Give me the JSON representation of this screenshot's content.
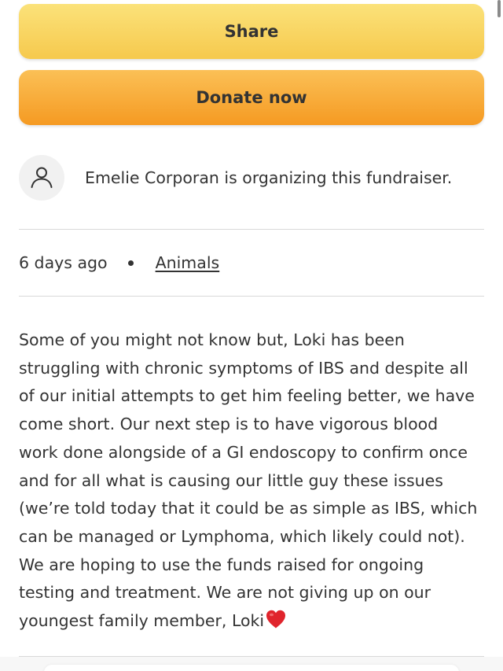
{
  "actions": {
    "share_label": "Share",
    "donate_label": "Donate now"
  },
  "organizer": {
    "avatar_icon": "user-icon",
    "text": "Emelie Corporan is organizing this fundraiser."
  },
  "meta": {
    "posted": "6 days ago",
    "category": "Animals"
  },
  "story": {
    "text": "Some of you might not know but, Loki has been\nstruggling with chronic symptoms of IBS and despite all\nof our initial attempts to get him feeling better, we have\ncome short. Our next step is to have vigorous blood\nwork done alongside of a GI endoscopy to confirm once\nand for all what is causing our little guy these issues\n(we’re told today that it could be as simple as IBS, which\ncan be managed or Lymphoma, which likely could not).\nWe are hoping to use the funds raised for ongoing\ntesting and treatment. We are not giving up on our\nyoungest family member, Loki",
    "end_icon": "red-heart-icon"
  },
  "colors": {
    "share_button": "#f8d45f",
    "donate_button": "#f7a833",
    "text": "#333333",
    "divider": "#d8d8d8",
    "heart": "#e0242c"
  }
}
